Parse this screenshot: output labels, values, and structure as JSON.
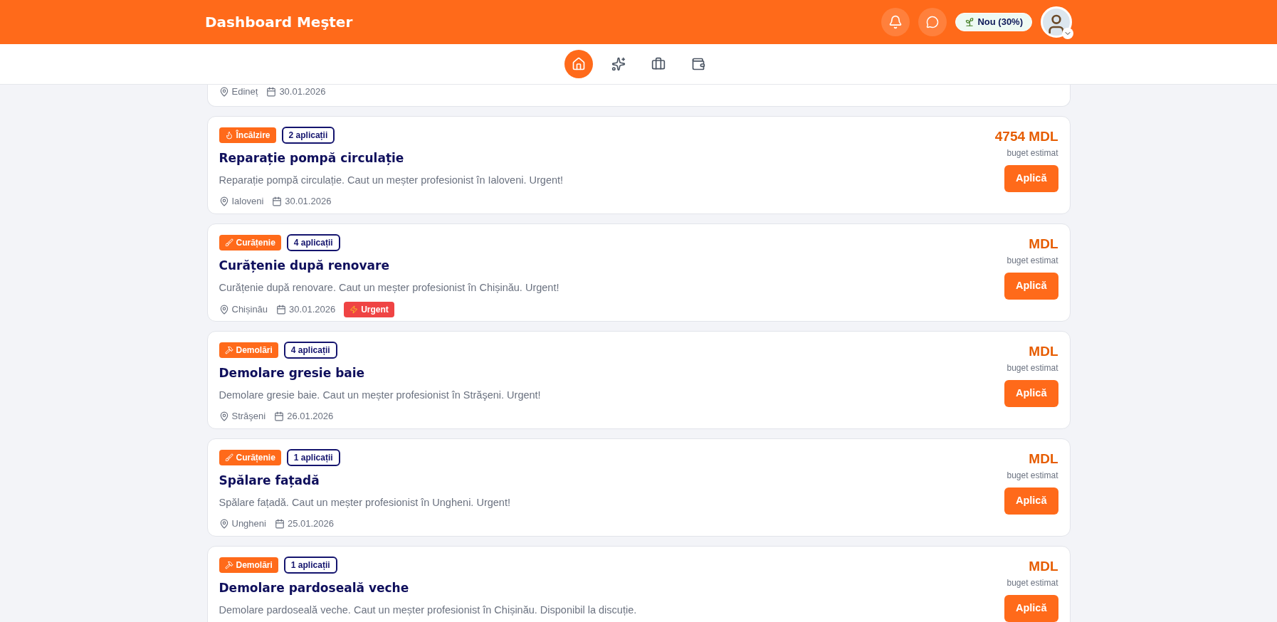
{
  "header": {
    "title": "Dashboard Meşter",
    "level_badge": "Nou (30%)"
  },
  "nav": [
    {
      "kind": "home",
      "selected": true
    },
    {
      "kind": "sparkles",
      "selected": false
    },
    {
      "kind": "briefcase",
      "selected": false
    },
    {
      "kind": "wallet",
      "selected": false
    }
  ],
  "partial_card": {
    "location": "Edineț",
    "date": "30.01.2026"
  },
  "jobs": [
    {
      "category": "Încălzire",
      "kind": "heating",
      "applications": "2 aplicații",
      "title": "Reparație pompă circulație",
      "description": "Reparație pompă circulație. Caut un meșter profesionist în Ialoveni. Urgent!",
      "location": "Ialoveni",
      "date": "30.01.2026",
      "urgent": false,
      "budget": "4754 MDL",
      "budget_label": "buget estimat",
      "apply": "Aplică"
    },
    {
      "category": "Curățenie",
      "kind": "cleaning",
      "applications": "4 aplicații",
      "title": "Curățenie după renovare",
      "description": "Curățenie după renovare. Caut un meșter profesionist în Chișinău. Urgent!",
      "location": "Chișinău",
      "date": "30.01.2026",
      "urgent": true,
      "urgent_label": "Urgent",
      "budget": "MDL",
      "budget_label": "buget estimat",
      "apply": "Aplică"
    },
    {
      "category": "Demolări",
      "kind": "demolition",
      "applications": "4 aplicații",
      "title": "Demolare gresie baie",
      "description": "Demolare gresie baie. Caut un meșter profesionist în Străşeni. Urgent!",
      "location": "Străşeni",
      "date": "26.01.2026",
      "urgent": false,
      "budget": "MDL",
      "budget_label": "buget estimat",
      "apply": "Aplică"
    },
    {
      "category": "Curățenie",
      "kind": "cleaning",
      "applications": "1 aplicații",
      "title": "Spălare fațadă",
      "description": "Spălare fațadă. Caut un meșter profesionist în Ungheni. Urgent!",
      "location": "Ungheni",
      "date": "25.01.2026",
      "urgent": false,
      "budget": "MDL",
      "budget_label": "buget estimat",
      "apply": "Aplică"
    },
    {
      "category": "Demolări",
      "kind": "demolition",
      "applications": "1 aplicații",
      "title": "Demolare pardoseală veche",
      "description": "Demolare pardoseală veche. Caut un meșter profesionist în Chișinău. Disponibil la discuție.",
      "budget": "MDL",
      "budget_label": "buget estimat",
      "apply": "Aplică"
    }
  ]
}
